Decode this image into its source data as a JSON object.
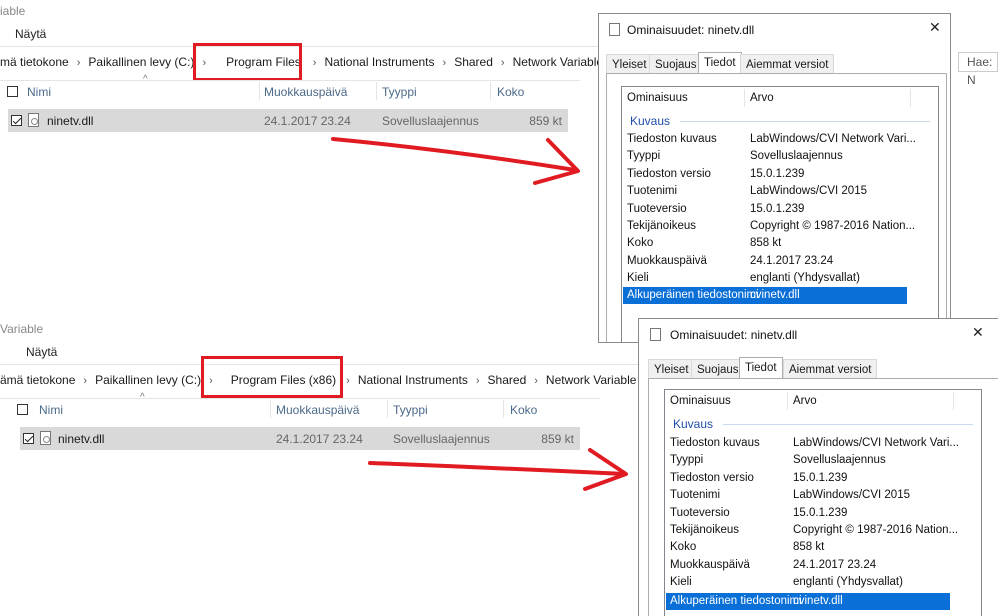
{
  "colors": {
    "annotation_red": "#e01b22",
    "selection_blue": "#0a6fd6",
    "group_blue": "#1f4ea8"
  },
  "top": {
    "cut_title": "iable",
    "menu_view": "Näytä",
    "breadcrumb": [
      "mä tietokone",
      "Paikallinen levy (C:)",
      "Program Files",
      "National Instruments",
      "Shared",
      "Network Variable"
    ],
    "highlighted_crumb": "Program Files",
    "search_placeholder": "Hae: N",
    "columns": [
      "Nimi",
      "Muokkauspäivä",
      "Tyyppi",
      "Koko"
    ],
    "file": {
      "name": "ninetv.dll",
      "date": "24.1.2017 23.24",
      "type": "Sovelluslaajennus",
      "size": "859 kt",
      "checked": true
    },
    "dialog": {
      "title": "Ominaisuudet: ninetv.dll",
      "close": "✕",
      "tabs": [
        "Yleiset",
        "Suojaus",
        "Tiedot",
        "Aiemmat versiot"
      ],
      "active_tab": "Tiedot",
      "list_headers": [
        "Ominaisuus",
        "Arvo"
      ],
      "group": "Kuvaus",
      "props": [
        {
          "k": "Tiedoston kuvaus",
          "v": "LabWindows/CVI Network Vari..."
        },
        {
          "k": "Tyyppi",
          "v": "Sovelluslaajennus"
        },
        {
          "k": "Tiedoston versio",
          "v": "15.0.1.239"
        },
        {
          "k": "Tuotenimi",
          "v": "LabWindows/CVI 2015"
        },
        {
          "k": "Tuoteversio",
          "v": "15.0.1.239"
        },
        {
          "k": "Tekijänoikeus",
          "v": "Copyright © 1987-2016 Nation..."
        },
        {
          "k": "Koko",
          "v": "858 kt"
        },
        {
          "k": "Muokkauspäivä",
          "v": "24.1.2017 23.24"
        },
        {
          "k": "Kieli",
          "v": "englanti (Yhdysvallat)"
        },
        {
          "k": "Alkuperäinen tiedostonimi",
          "v": "cvinetv.dll"
        }
      ]
    }
  },
  "bottom": {
    "cut_title": "Variable",
    "menu_view": "Näytä",
    "breadcrumb": [
      "ämä tietokone",
      "Paikallinen levy (C:)",
      "Program Files (x86)",
      "National Instruments",
      "Shared",
      "Network Variable"
    ],
    "highlighted_crumb": "Program Files (x86)",
    "columns": [
      "Nimi",
      "Muokkauspäivä",
      "Tyyppi",
      "Koko"
    ],
    "file": {
      "name": "ninetv.dll",
      "date": "24.1.2017 23.24",
      "type": "Sovelluslaajennus",
      "size": "859 kt",
      "checked": true
    },
    "dialog": {
      "title": "Ominaisuudet: ninetv.dll",
      "close": "✕",
      "tabs": [
        "Yleiset",
        "Suojaus",
        "Tiedot",
        "Aiemmat versiot"
      ],
      "active_tab": "Tiedot",
      "list_headers": [
        "Ominaisuus",
        "Arvo"
      ],
      "group": "Kuvaus",
      "props": [
        {
          "k": "Tiedoston kuvaus",
          "v": "LabWindows/CVI Network Vari..."
        },
        {
          "k": "Tyyppi",
          "v": "Sovelluslaajennus"
        },
        {
          "k": "Tiedoston versio",
          "v": "15.0.1.239"
        },
        {
          "k": "Tuotenimi",
          "v": "LabWindows/CVI 2015"
        },
        {
          "k": "Tuoteversio",
          "v": "15.0.1.239"
        },
        {
          "k": "Tekijänoikeus",
          "v": "Copyright © 1987-2016 Nation..."
        },
        {
          "k": "Koko",
          "v": "858 kt"
        },
        {
          "k": "Muokkauspäivä",
          "v": "24.1.2017 23.24"
        },
        {
          "k": "Kieli",
          "v": "englanti (Yhdysvallat)"
        },
        {
          "k": "Alkuperäinen tiedostonimi",
          "v": "cvinetv.dll"
        }
      ]
    }
  }
}
